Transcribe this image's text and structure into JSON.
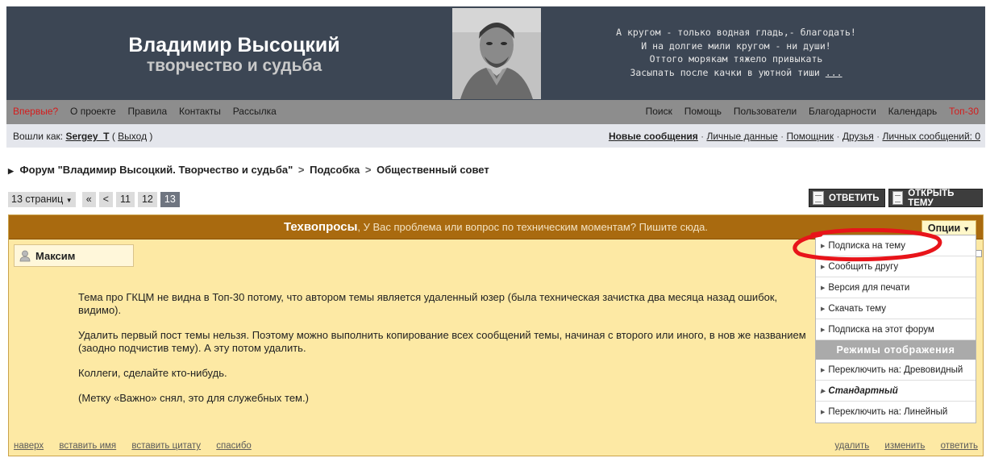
{
  "header": {
    "title": "Владимир Высоцкий",
    "subtitle": "творчество и судьба",
    "poem_lines": [
      "А кругом - только водная гладь,- благодать!",
      "И на долгие мили кругом - ни души!",
      "Оттого морякам тяжело привыкать",
      "Засыпать после качки в уютной тиши"
    ],
    "poem_more": "..."
  },
  "topnav": {
    "left": [
      "Впервые?",
      "О проекте",
      "Правила",
      "Контакты",
      "Рассылка"
    ],
    "right": [
      "Поиск",
      "Помощь",
      "Пользователи",
      "Благодарности",
      "Календарь",
      "Топ-30"
    ]
  },
  "userbar": {
    "logged_in_label": "Вошли как:",
    "username": "Sergey_T",
    "logout": "Выход",
    "links": [
      "Новые сообщения",
      "Личные данные",
      "Помощник",
      "Друзья",
      "Личных сообщений: 0"
    ]
  },
  "breadcrumb": {
    "items": [
      "Форум \"Владимир Высоцкий. Творчество и судьба\"",
      "Подсобка",
      "Общественный совет"
    ]
  },
  "pager": {
    "pages_label": "13 страниц",
    "first": "«",
    "prev": "<",
    "pages": [
      "11",
      "12",
      "13"
    ],
    "current": "13"
  },
  "buttons": {
    "reply": "ОТВЕТИТЬ",
    "new_topic": "ОТКРЫТЬ ТЕМУ"
  },
  "topic": {
    "title": "Техвопросы",
    "description": ", У Вас проблема или вопрос по техническим моментам? Пишите сюда.",
    "options_label": "Опции"
  },
  "post": {
    "author": "Максим",
    "paragraphs": [
      "Тема про ГКЦМ не видна в Топ-30 потому, что автором темы является удаленный юзер (была техническая зачистка два месяца назад ошибок, видимо).",
      "Удалить первый пост темы нельзя. Поэтому можно выполнить копирование всех сообщений темы, начиная с второго или иного, в нов же названием (заодно подчистив тему). А эту потом удалить.",
      "Коллеги, сделайте кто-нибудь.",
      "(Метку «Важно» снял, это для служебных тем.)"
    ],
    "links_left": [
      "наверх",
      "вставить имя",
      "вставить цитату",
      "спасибо"
    ],
    "links_right": [
      "удалить",
      "изменить",
      "ответить"
    ]
  },
  "options_menu": {
    "items": [
      "Подписка на тему",
      "Сообщить другу",
      "Версия для печати",
      "Скачать тему",
      "Подписка на этот форум"
    ],
    "section_title": "Режимы отображения",
    "modes": [
      "Переключить на: Древовидный",
      "Стандартный",
      "Переключить на: Линейный"
    ]
  },
  "colors": {
    "header_bg": "#3c4654",
    "topic_header_bg": "#a96a0f",
    "topic_bg": "#fde9a4",
    "annotation": "#e8141a"
  }
}
